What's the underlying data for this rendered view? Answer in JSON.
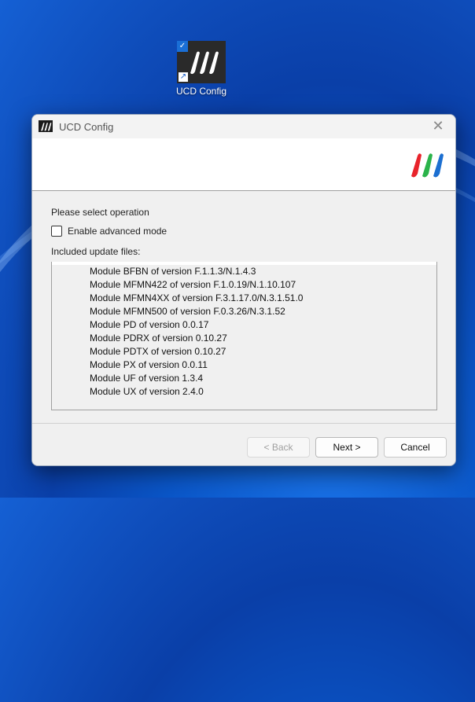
{
  "desktop": {
    "icon_label": "UCD Config",
    "icon_name": "ucd-config-logo-icon"
  },
  "dialog": {
    "title": "UCD Config",
    "close_glyph": "✕",
    "prompt": "Please select operation",
    "advanced_label": "Enable advanced mode",
    "advanced_checked": false,
    "included_label": "Included update files:",
    "modules": [
      "Module BFBN of version F.1.1.3/N.1.4.3",
      "Module MFMN422 of version F.1.0.19/N.1.10.107",
      "Module MFMN4XX of version F.3.1.17.0/N.3.1.51.0",
      "Module MFMN500 of version F.0.3.26/N.3.1.52",
      "Module PD of version 0.0.17",
      "Module PDRX of version 0.10.27",
      "Module PDTX of version 0.10.27",
      "Module PX of version 0.0.11",
      "Module UF of version 1.3.4",
      "Module UX of version 2.4.0"
    ],
    "buttons": {
      "back": "< Back",
      "next": "Next >",
      "cancel": "Cancel"
    }
  },
  "colors": {
    "logo_red": "#e8232b",
    "logo_green": "#2bb34a",
    "logo_blue": "#1c6fd1",
    "desktop_blue": "#0a56c8"
  }
}
